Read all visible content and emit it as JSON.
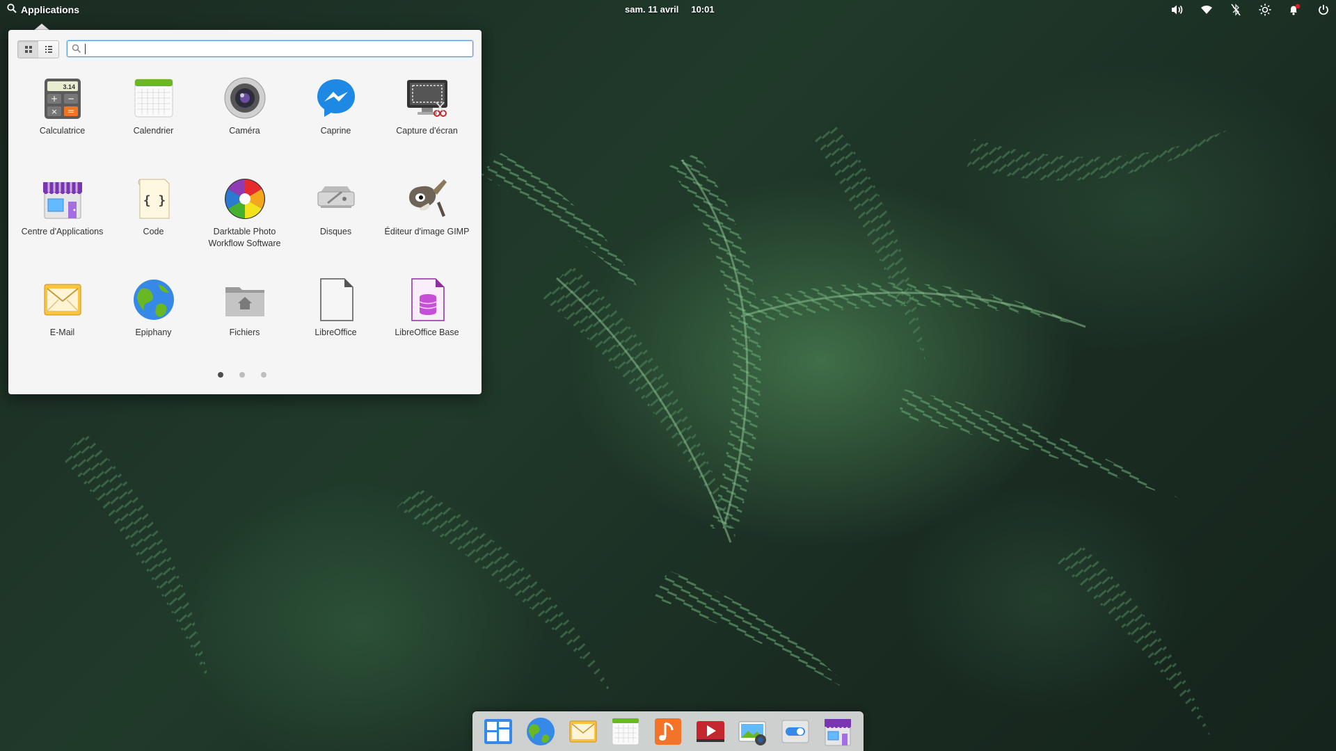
{
  "panel": {
    "applications_label": "Applications",
    "date": "sam. 11 avril",
    "time": "10:01",
    "indicators": [
      {
        "name": "volume-icon"
      },
      {
        "name": "wifi-icon"
      },
      {
        "name": "bluetooth-off-icon"
      },
      {
        "name": "brightness-icon"
      },
      {
        "name": "notifications-icon"
      },
      {
        "name": "power-icon"
      }
    ]
  },
  "menu": {
    "search": {
      "value": "",
      "placeholder": ""
    },
    "view_modes": [
      "grid-view-icon",
      "category-view-icon"
    ],
    "apps": [
      {
        "label": "Calculatrice",
        "icon": "calculator-icon"
      },
      {
        "label": "Calendrier",
        "icon": "calendar-icon"
      },
      {
        "label": "Caméra",
        "icon": "camera-icon"
      },
      {
        "label": "Caprine",
        "icon": "messenger-icon"
      },
      {
        "label": "Capture d'écran",
        "icon": "screenshot-icon"
      },
      {
        "label": "Centre d'Applications",
        "icon": "appcenter-icon"
      },
      {
        "label": "Code",
        "icon": "code-icon"
      },
      {
        "label": "Darktable Photo Workflow Software",
        "icon": "darktable-icon"
      },
      {
        "label": "Disques",
        "icon": "disks-icon"
      },
      {
        "label": "Éditeur d'image GIMP",
        "icon": "gimp-icon"
      },
      {
        "label": "E-Mail",
        "icon": "mail-icon"
      },
      {
        "label": "Epiphany",
        "icon": "browser-icon"
      },
      {
        "label": "Fichiers",
        "icon": "files-icon"
      },
      {
        "label": "LibreOffice",
        "icon": "libreoffice-icon"
      },
      {
        "label": "LibreOffice Base",
        "icon": "libreoffice-base-icon"
      }
    ],
    "pages": {
      "total": 3,
      "current": 1
    }
  },
  "dock": {
    "items": [
      {
        "name": "multitasking-view-icon"
      },
      {
        "name": "browser-icon"
      },
      {
        "name": "mail-icon"
      },
      {
        "name": "calendar-icon"
      },
      {
        "name": "music-icon"
      },
      {
        "name": "videos-icon"
      },
      {
        "name": "photos-icon"
      },
      {
        "name": "system-settings-icon"
      },
      {
        "name": "appcenter-icon"
      }
    ]
  },
  "colors": {
    "accent": "#3689e6",
    "panel_text": "#ffffff",
    "menu_bg": "#f5f5f5"
  }
}
